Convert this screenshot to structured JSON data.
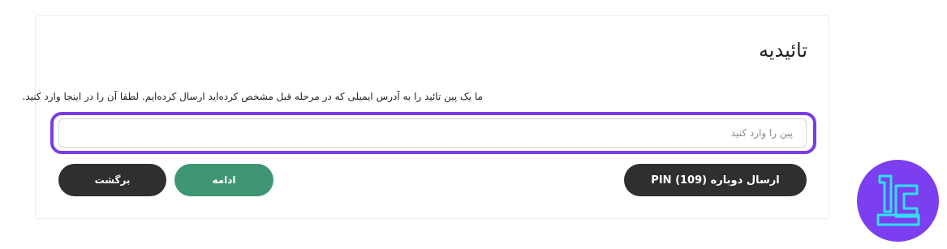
{
  "card": {
    "title": "تائیدیه",
    "description": "ما یک پین تائید را به آدرس ایمیلی که در مرحله قبل مشخص کرده‌اید ارسال کرده‌ایم. لطفا آن را در اینجا وارد کنید."
  },
  "pin_field": {
    "placeholder": "پین را وارد کنید",
    "value": ""
  },
  "buttons": {
    "back_label": "برگشت",
    "continue_label": "ادامه",
    "resend_label": "ارسال دوباره PIN (109)"
  },
  "colors": {
    "highlight": "#7a3ce6",
    "continue_button": "#3f9672",
    "dark_button": "#2f2f2f",
    "logo_background": "#7b3ff0",
    "logo_mark": "#2fe0f0"
  },
  "logo": {
    "icon": "brand-logo-icon"
  }
}
